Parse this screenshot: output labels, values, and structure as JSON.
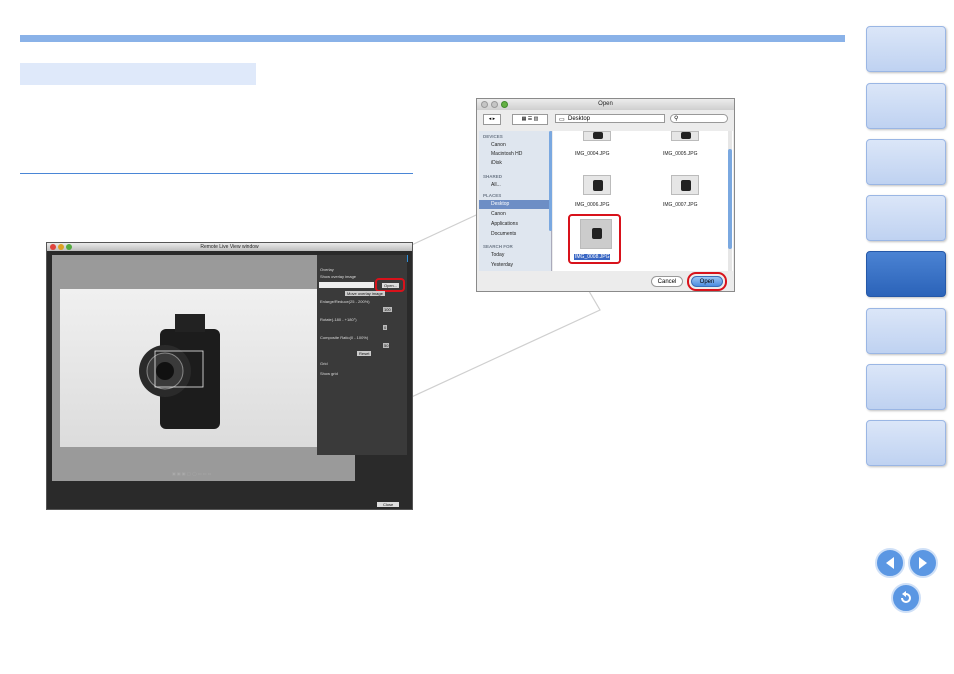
{
  "remote_live_view": {
    "window_title": "Remote Live View window",
    "tab_live_view": "Live View",
    "tab_compare": "Compare",
    "section_overlay": "Overlay",
    "show_overlay_image": "Show overlay image",
    "open_button": "Open...",
    "move_overlay_button": "Move overlay image",
    "enlarge_label": "Enlarge/Reduce(25 - 200%)",
    "enlarge_value": "100",
    "rotate_label": "Rotate(-180 - +180°)",
    "rotate_value": "0",
    "composite_label": "Composite Ratio(0 - 100%)",
    "composite_value": "50",
    "reset_button": "Reset",
    "section_grid": "Grid",
    "show_grid": "Show grid",
    "close_button": "Close"
  },
  "open_dialog": {
    "title": "Open",
    "location": "Desktop",
    "sidebar": {
      "devices_heading": "DEVICES",
      "devices": [
        "Canon",
        "Macintosh HD",
        "iDisk"
      ],
      "shared_heading": "SHARED",
      "shared": [
        "All..."
      ],
      "places_heading": "PLACES",
      "places": [
        "Desktop",
        "Canon",
        "Applications",
        "Documents"
      ],
      "search_heading": "SEARCH FOR",
      "search": [
        "Today",
        "Yesterday"
      ]
    },
    "files": [
      "IMG_0004.JPG",
      "IMG_0005.JPG",
      "IMG_0006.JPG",
      "IMG_0007.JPG",
      "IMG_0008.JPG"
    ],
    "cancel_button": "Cancel",
    "open_button": "Open"
  },
  "colors": {
    "accent_blue": "#8ab2e8",
    "highlight_red": "#d8121b",
    "active_side": "#2b63b9"
  }
}
